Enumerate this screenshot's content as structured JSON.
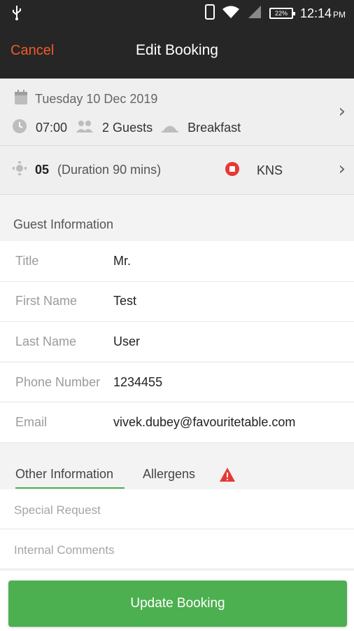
{
  "status_bar": {
    "battery": "22%",
    "time": "12:14",
    "ampm": "PM"
  },
  "header": {
    "cancel_label": "Cancel",
    "title": "Edit Booking"
  },
  "summary": {
    "date": "Tuesday 10 Dec 2019",
    "time": "07:00",
    "guests": "2 Guests",
    "meal": "Breakfast"
  },
  "table": {
    "number": "05",
    "duration": "(Duration 90 mins)",
    "status_code": "KNS"
  },
  "guest_section": {
    "title": "Guest Information",
    "fields": [
      {
        "label": "Title",
        "value": "Mr."
      },
      {
        "label": "First Name",
        "value": "Test"
      },
      {
        "label": "Last Name",
        "value": "User"
      },
      {
        "label": "Phone Number",
        "value": "1234455"
      },
      {
        "label": "Email",
        "value": "vivek.dubey@favouritetable.com"
      }
    ]
  },
  "tabs": {
    "other": "Other Information",
    "allergens": "Allergens"
  },
  "other": {
    "special_request_placeholder": "Special Request",
    "internal_comments_placeholder": "Internal Comments"
  },
  "footer": {
    "update_label": "Update Booking"
  },
  "colors": {
    "accent": "#4caf50",
    "cancel": "#f05a28",
    "status_red": "#e53935",
    "warning": "#e53935",
    "bar": "#262626"
  }
}
